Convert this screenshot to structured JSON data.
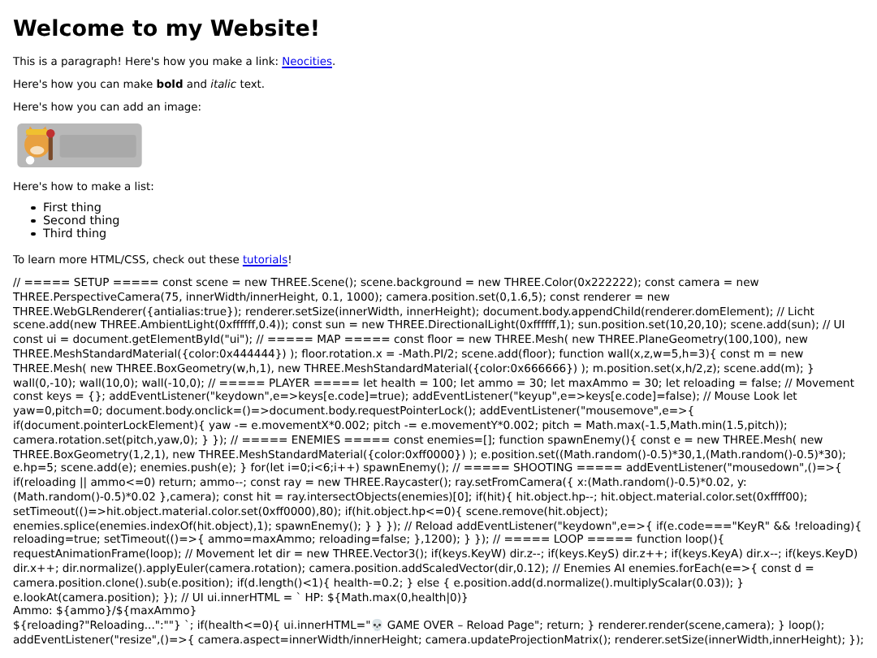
{
  "heading": "Welcome to my Website!",
  "paragraphs": [
    {
      "text": "This is a paragraph! Here's how you make a link: ",
      "link": "Neocities",
      "after": "."
    },
    {
      "text": "Here's how you can make **bold** and *italic* text."
    },
    {
      "text": "Here's how you can add an image:"
    }
  ],
  "list_intro": "Here's how to make a list:",
  "list_items": [
    "First thing",
    "Second thing",
    "Third thing"
  ],
  "outro": {
    "text": "To learn more HTML/CSS, check out these ",
    "link": "tutorials",
    "after": "!"
  },
  "code_lines": [
    "// ===== SETUP ===== const scene = new THREE.Scene(); scene.background = new THREE.Color(0x222222); const camera = new THREE.PerspectiveCamera(75, innerWidth/innerHeight, 0.1, 1000); camera.position.set(0,1.6,5); const renderer = new THREE.WebGLRenderer({antialias:true}); renderer.setSize(innerWidth, innerHeight); document.body.appendChild(renderer.domElement); // Licht scene.add(new THREE.AmbientLight(0xffffff,0.4)); const sun = new THREE.DirectionalLight(0xffffff,1); sun.position.set(10,20,10); scene.add(sun); // UI const ui = document.getElementById(\"ui\"); // ===== MAP ===== const floor = new THREE.Mesh( new THREE.PlaneGeometry(100,100), new THREE.MeshStandardMaterial({color:0x444444}) ); floor.rotation.x = -Math.PI/2; scene.add(floor); function wall(x,z,w=5,h=3){ const m = new THREE.Mesh( new THREE.BoxGeometry(w,h,1), new THREE.MeshStandardMaterial({color:0x666666}) ); m.position.set(x,h/2,z); scene.add(m); } wall(0,-10); wall(10,0); wall(-10,0); // ===== PLAYER ===== let health = 100; let ammo = 30; let maxAmmo = 30; let reloading = false; // Movement const keys = {}; addEventListener(\"keydown\",e=>keys[e.code]=true); addEventListener(\"keyup\",e=>keys[e.code]=false); // Mouse Look let yaw=0,pitch=0; document.body.onclick=()=>document.body.requestPointerLock(); addEventListener(\"mousemove\",e=>{ if(document.pointerLockElement){ yaw -= e.movementX*0.002; pitch -= e.movementY*0.002; pitch = Math.max(-1.5,Math.min(1.5,pitch)); camera.rotation.set(pitch,yaw,0); } }); // ===== ENEMIES ===== const enemies=[]; function spawnEnemy(){ const e = new THREE.Mesh( new THREE.BoxGeometry(1,2,1), new THREE.MeshStandardMaterial({color:0xff0000}) ); e.position.set((Math.random()-0.5)*30,1,(Math.random()-0.5)*30); e.hp=5; scene.add(e); enemies.push(e); } for(let i=0;i<6;i++) spawnEnemy(); // ===== SHOOTING ===== addEventListener(\"mousedown\",()=>{ if(reloading || ammo<=0) return; ammo--; const ray = new THREE.Raycaster(); ray.setFromCamera({ x:(Math.random()-0.5)*0.02, y:(Math.random()-0.5)*0.02 },camera); const hit = ray.intersectObjects(enemies)[0]; if(hit){ hit.object.hp--; hit.object.material.color.set(0xffff00); setTimeout(()=>hit.object.material.color.set(0xff0000),80); if(hit.object.hp<=0){ scene.remove(hit.object); enemies.splice(enemies.indexOf(hit.object),1); spawnEnemy(); } } }); // Reload addEventListener(\"keydown\",e=>{ if(e.code===\"KeyR\" && !reloading){ reloading=true; setTimeout(()=>{ ammo=maxAmmo; reloading=false; },1200); } }); // ===== LOOP ===== function loop(){ requestAnimationFrame(loop); // Movement let dir = new THREE.Vector3(); if(keys.KeyW) dir.z--; if(keys.KeyS) dir.z++; if(keys.KeyA) dir.x--; if(keys.KeyD) dir.x++; dir.normalize().applyEuler(camera.rotation); camera.position.addScaledVector(dir,0.12); // Enemies AI enemies.forEach(e=>{ const d = camera.position.clone().sub(e.position); if(d.length()<1){ health-=0.2; } else { e.position.add(d.normalize().multiplyScalar(0.03)); } e.lookAt(camera.position); }); // UI ui.innerHTML = ` HP: ${Math.max(0,health|0)}",
    "Ammo: ${ammo}/${maxAmmo}",
    "${reloading?\"Reloading...\":\"\"} `; if(health<=0){ ui.innerHTML=\"💀 GAME OVER – Reload Page\"; return; } renderer.render(scene,camera); } loop(); addEventListener(\"resize\",()=>{ camera.aspect=innerWidth/innerHeight; camera.updateProjectionMatrix(); renderer.setSize(innerWidth,innerHeight); });"
  ]
}
